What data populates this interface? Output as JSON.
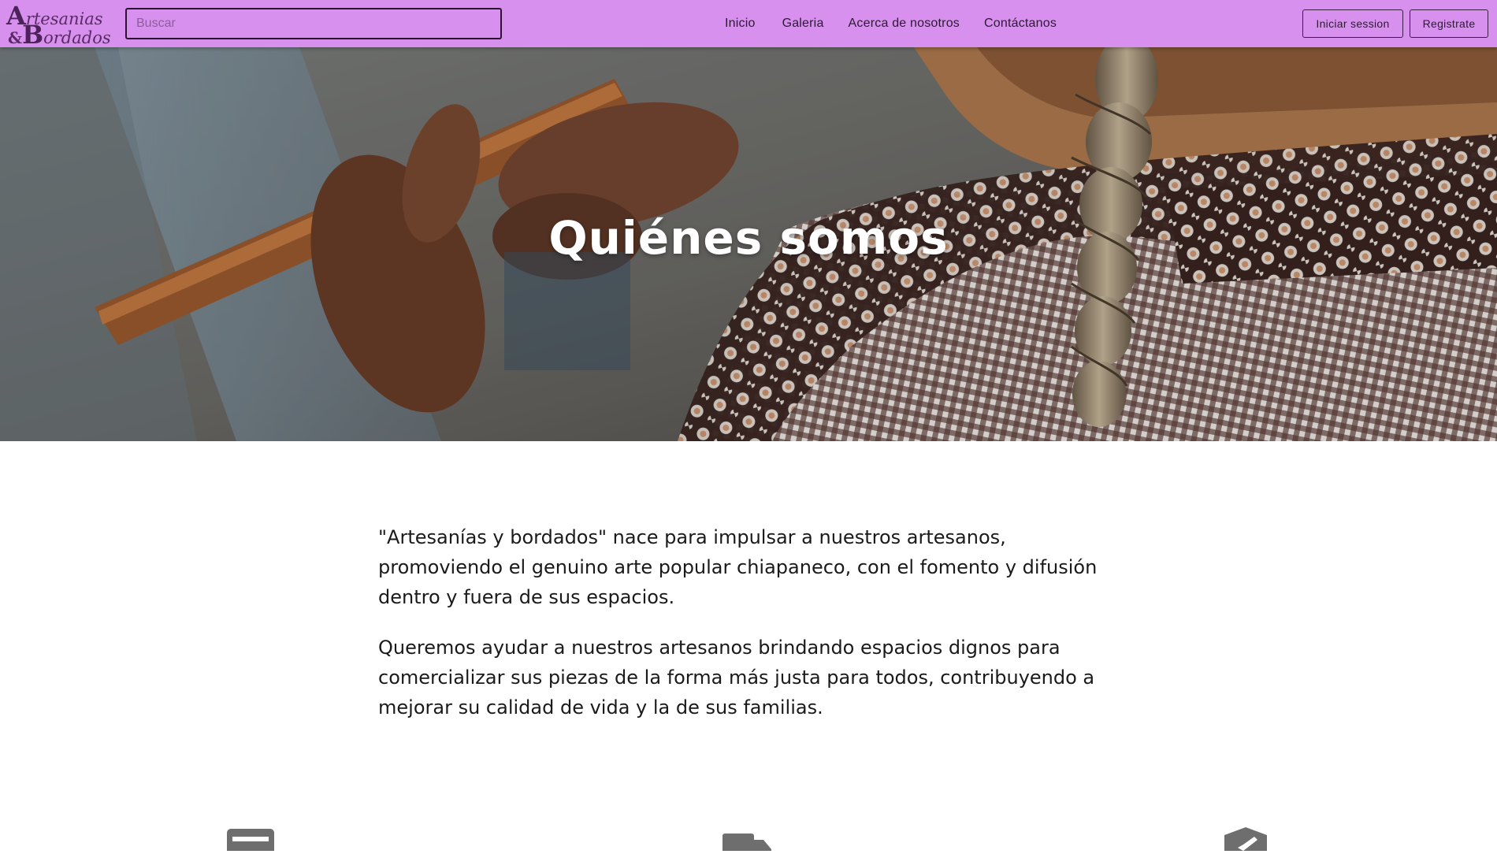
{
  "navbar": {
    "logo": {
      "line1_big": "A",
      "line1_small": "rtesanias",
      "line2_amp": "&",
      "line2_big": "B",
      "line2_small": "ordados"
    },
    "search_placeholder": "Buscar",
    "links": [
      {
        "label": "Inicio"
      },
      {
        "label": "Galeria"
      },
      {
        "label": "Acerca de nosotros"
      },
      {
        "label": "Contáctanos"
      }
    ],
    "login_label": "Iniciar session",
    "register_label": "Registrate"
  },
  "hero": {
    "title": "Quiénes somos"
  },
  "about": {
    "paragraph1": "\"Artesanías y bordados\" nace para impulsar a nuestros artesanos, promoviendo el genuino arte popular chiapaneco, con el fomento y difusión dentro y fuera de sus espacios.",
    "paragraph2": "Queremos ayudar a nuestros artesanos brindando espacios dignos para comercializar sus piezas de la forma más justa para todos, contribuyendo a mejorar su calidad de vida y la de sus familias."
  },
  "features": [
    {
      "icon": "credit-card-icon"
    },
    {
      "icon": "truck-icon"
    },
    {
      "icon": "shield-check-icon"
    }
  ],
  "colors": {
    "navbar_bg": "#d890ef",
    "logo": "#4d2159",
    "text": "#1a1a1a",
    "icon": "#6e6e6e"
  }
}
